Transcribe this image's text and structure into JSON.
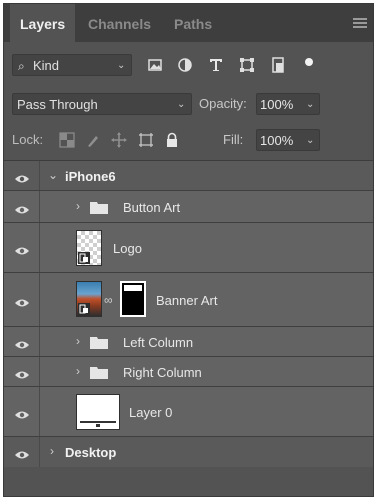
{
  "tabs": [
    {
      "label": "Layers",
      "active": true
    },
    {
      "label": "Channels",
      "active": false
    },
    {
      "label": "Paths",
      "active": false
    }
  ],
  "filter": {
    "kind_label": "Kind",
    "icons": [
      "image-filter-icon",
      "adjustment-filter-icon",
      "type-filter-icon",
      "shape-filter-icon",
      "smart-object-filter-icon",
      "filter-toggle-icon"
    ]
  },
  "blend": {
    "mode": "Pass Through",
    "opacity_label": "Opacity:",
    "opacity_value": "100%"
  },
  "lock": {
    "label": "Lock:",
    "icons": [
      "lock-transparent-pixels-icon",
      "lock-image-pixels-icon",
      "lock-position-icon",
      "lock-artboard-icon",
      "lock-all-icon"
    ],
    "fill_label": "Fill:",
    "fill_value": "100%"
  },
  "layers": [
    {
      "name": "iPhone6",
      "kind": "artboard",
      "expanded": true
    },
    {
      "name": "Button Art",
      "kind": "group",
      "expanded": false
    },
    {
      "name": "Logo",
      "kind": "smart-object"
    },
    {
      "name": "Banner Art",
      "kind": "smart-object-with-mask"
    },
    {
      "name": "Left Column",
      "kind": "group",
      "expanded": false
    },
    {
      "name": "Right Column",
      "kind": "group",
      "expanded": false
    },
    {
      "name": "Layer 0",
      "kind": "pixel"
    },
    {
      "name": "Desktop",
      "kind": "artboard",
      "expanded": false
    }
  ],
  "colors": {
    "panel_bg": "#535353",
    "tabbar_bg": "#3e3e3e",
    "nested_row_bg": "#636363"
  }
}
